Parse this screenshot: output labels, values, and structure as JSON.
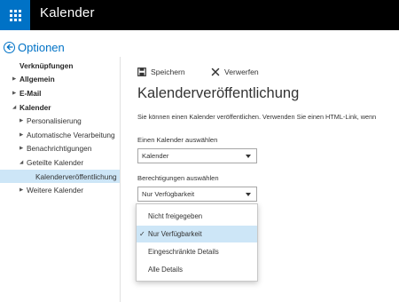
{
  "app": {
    "title": "Kalender"
  },
  "options": {
    "label": "Optionen"
  },
  "sidebar": {
    "items": [
      {
        "label": "Verknüpfungen"
      },
      {
        "label": "Allgemein",
        "caret": "▶"
      },
      {
        "label": "E-Mail",
        "caret": "▶"
      },
      {
        "label": "Kalender",
        "caret": "◢"
      },
      {
        "label": "Personalisierung",
        "caret": "▶"
      },
      {
        "label": "Automatische Verarbeitung",
        "caret": "▶"
      },
      {
        "label": "Benachrichtigungen",
        "caret": "▶"
      },
      {
        "label": "Geteilte Kalender",
        "caret": "◢"
      },
      {
        "label": "Kalenderveröffentlichung"
      },
      {
        "label": "Weitere Kalender",
        "caret": "▶"
      }
    ]
  },
  "toolbar": {
    "save_label": "Speichern",
    "discard_label": "Verwerfen"
  },
  "main": {
    "title": "Kalenderveröffentlichung",
    "description": "Sie können einen Kalender veröffentlichen. Verwenden Sie einen HTML-Link, wenn",
    "calendar_label": "Einen Kalender auswählen",
    "calendar_value": "Kalender",
    "permissions_label": "Berechtigungen auswählen",
    "permissions_value": "Nur Verfügbarkeit"
  },
  "dropdown": {
    "check": "✓",
    "options": [
      {
        "label": "Nicht freigegeben"
      },
      {
        "label": "Nur Verfügbarkeit"
      },
      {
        "label": "Eingeschränkte Details"
      },
      {
        "label": "Alle Details"
      }
    ]
  },
  "colors": {
    "accent": "#0072c6",
    "topbar": "#000000",
    "selection": "#cde6f7"
  }
}
